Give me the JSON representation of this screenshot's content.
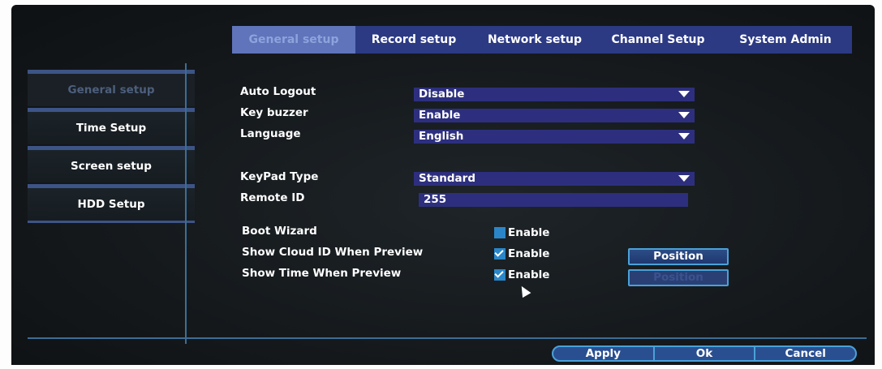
{
  "tabs": [
    {
      "label": "General setup",
      "active": true
    },
    {
      "label": "Record setup",
      "active": false
    },
    {
      "label": "Network setup",
      "active": false
    },
    {
      "label": "Channel Setup",
      "active": false
    },
    {
      "label": "System Admin",
      "active": false
    }
  ],
  "sidebar": {
    "items": [
      {
        "label": "General setup",
        "active": true
      },
      {
        "label": "Time Setup",
        "active": false
      },
      {
        "label": "Screen setup",
        "active": false
      },
      {
        "label": "HDD Setup",
        "active": false
      }
    ]
  },
  "form": {
    "auto_logout": {
      "label": "Auto Logout",
      "value": "Disable"
    },
    "key_buzzer": {
      "label": "Key buzzer",
      "value": "Enable"
    },
    "language": {
      "label": "Language",
      "value": "English"
    },
    "keypad_type": {
      "label": "KeyPad Type",
      "value": "Standard"
    },
    "remote_id": {
      "label": "Remote ID",
      "value": "255"
    },
    "boot_wizard": {
      "label": "Boot Wizard",
      "option": "Enable",
      "checked": false
    },
    "show_cloud_id": {
      "label": "Show Cloud ID When Preview",
      "option": "Enable",
      "checked": true,
      "button": "Position"
    },
    "show_time": {
      "label": "Show Time When Preview",
      "option": "Enable",
      "checked": true,
      "button": "Position"
    }
  },
  "buttons": {
    "apply": "Apply",
    "ok": "Ok",
    "cancel": "Cancel"
  },
  "colors": {
    "tab_bar": "#2c3a84",
    "field_bg": "#2d2f7e",
    "accent_border": "#4aa1d8",
    "checkbox": "#2a86c8"
  }
}
